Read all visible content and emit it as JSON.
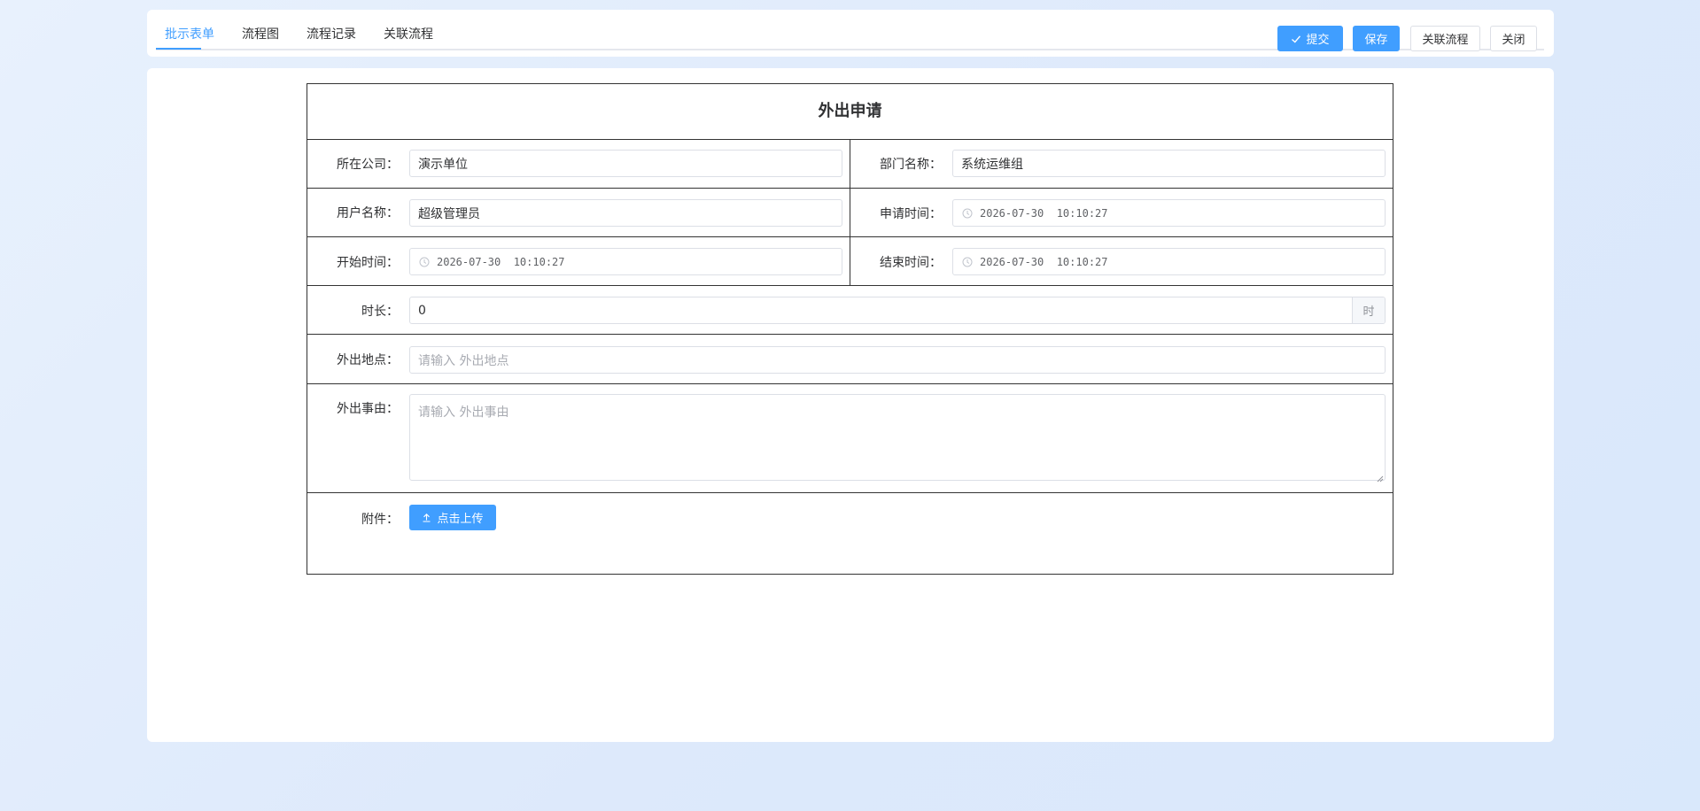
{
  "tabs": [
    {
      "label": "批示表单",
      "active": true
    },
    {
      "label": "流程图",
      "active": false
    },
    {
      "label": "流程记录",
      "active": false
    },
    {
      "label": "关联流程",
      "active": false
    }
  ],
  "toolbar": {
    "submit_label": "提交",
    "save_label": "保存",
    "related_flow_label": "关联流程",
    "close_label": "关闭"
  },
  "form": {
    "title": "外出申请",
    "company": {
      "label": "所在公司：",
      "value": "演示单位"
    },
    "department": {
      "label": "部门名称：",
      "value": "系统运维组"
    },
    "user": {
      "label": "用户名称：",
      "value": "超级管理员"
    },
    "apply_time": {
      "label": "申请时间：",
      "value": "2026-07-30  10:10:27"
    },
    "start_time": {
      "label": "开始时间：",
      "value": "2026-07-30  10:10:27"
    },
    "end_time": {
      "label": "结束时间：",
      "value": "2026-07-30  10:10:27"
    },
    "duration": {
      "label": "时长：",
      "value": "0",
      "unit": "时"
    },
    "location": {
      "label": "外出地点：",
      "placeholder": "请输入 外出地点"
    },
    "reason": {
      "label": "外出事由：",
      "placeholder": "请输入 外出事由"
    },
    "attachment": {
      "label": "附件：",
      "upload_label": "点击上传"
    }
  },
  "colors": {
    "primary": "#409eff",
    "border": "#dcdfe6",
    "table_line": "#333333",
    "background": "#e3eefc"
  },
  "icons": {
    "submit": "check-icon",
    "date": "clock-icon",
    "upload": "upload-icon"
  }
}
